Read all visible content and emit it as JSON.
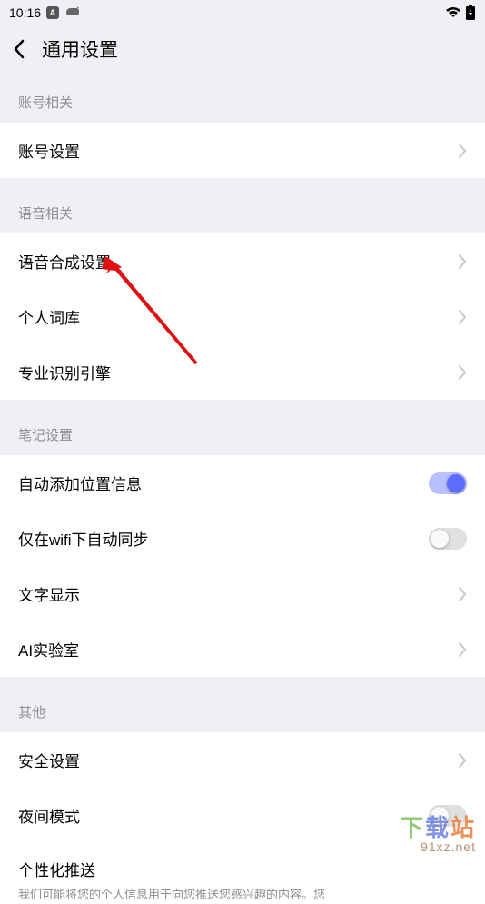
{
  "status": {
    "time": "10:16"
  },
  "header": {
    "title": "通用设置"
  },
  "sections": {
    "account": {
      "header": "账号相关",
      "items": {
        "settings": "账号设置"
      }
    },
    "voice": {
      "header": "语音相关",
      "items": {
        "tts": "语音合成设置",
        "lexicon": "个人词库",
        "engine": "专业识别引擎"
      }
    },
    "notes": {
      "header": "笔记设置",
      "items": {
        "location": "自动添加位置信息",
        "wifi_sync": "仅在wifi下自动同步",
        "text_display": "文字显示",
        "ai_lab": "AI实验室"
      }
    },
    "other": {
      "header": "其他",
      "items": {
        "security": "安全设置",
        "night_mode": "夜间模式",
        "personalization": {
          "title": "个性化推送",
          "desc": "我们可能将您的个人信息用于向您推送您感兴趣的内容。您"
        }
      }
    }
  },
  "watermark": {
    "brand_c1": "下",
    "brand_c2": "载",
    "brand_c3": "站",
    "url": "91xz.net"
  }
}
